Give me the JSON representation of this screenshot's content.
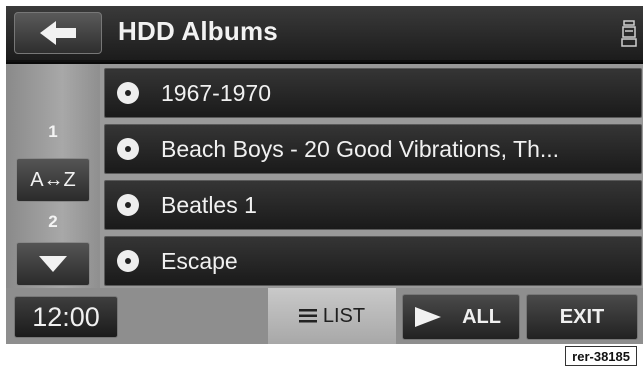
{
  "header": {
    "title": "HDD Albums",
    "back_icon": "arrow-left-icon",
    "device_icon": "hdd-device-icon"
  },
  "sidebar": {
    "page_top": "1",
    "sort_label": "A↔Z",
    "page_bottom": "2",
    "down_icon": "triangle-down-icon"
  },
  "albums": [
    {
      "label": "1967-1970"
    },
    {
      "label": "Beach Boys - 20 Good Vibrations, Th..."
    },
    {
      "label": "Beatles 1"
    },
    {
      "label": "Escape"
    }
  ],
  "bottombar": {
    "clock": "12:00",
    "list_label": "LIST",
    "list_icon": "list-icon",
    "all_label": "ALL",
    "play_icon": "play-icon",
    "exit_label": "EXIT"
  },
  "reference_tag": "rer-38185",
  "colors": {
    "screen_bg": "#0a0a0a",
    "panel_grey": "#9a9a9a",
    "text": "#f0f0f0"
  }
}
